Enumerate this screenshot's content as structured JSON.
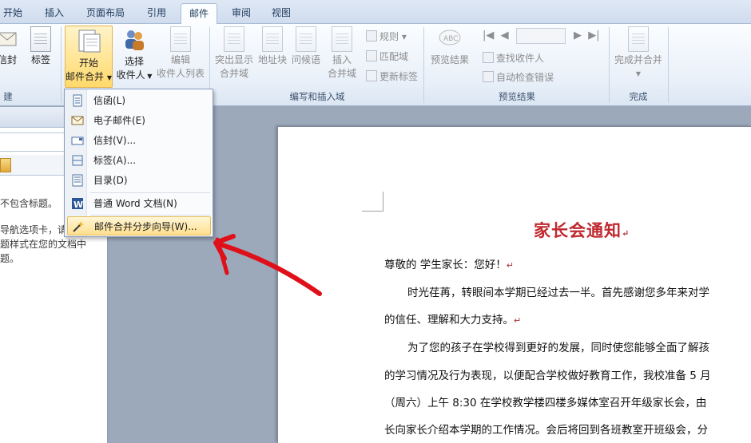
{
  "tabs": [
    "开始",
    "插入",
    "页面布局",
    "引用",
    "邮件",
    "审阅",
    "视图"
  ],
  "active_tab": "邮件",
  "ribbon": {
    "create_group": {
      "envelope": "信封",
      "labels": "标签",
      "label_partial": "建"
    },
    "start_group": {
      "start_merge_line1": "开始",
      "start_merge_line2": "邮件合并",
      "select_recipients_line1": "选择",
      "select_recipients_line2": "收件人",
      "edit_recipients_line1": "编辑",
      "edit_recipients_line2": "收件人列表"
    },
    "write_insert_group": {
      "highlight_line1": "突出显示",
      "highlight_line2": "合并域",
      "address_block": "地址块",
      "greeting_line": "问候语",
      "insert_field_line1": "插入",
      "insert_field_line2": "合并域",
      "rules": "规则",
      "match_fields": "匹配域",
      "update_labels": "更新标签",
      "label": "编写和插入域"
    },
    "preview_group": {
      "preview_results": "预览结果",
      "find_recipient": "查找收件人",
      "auto_check": "自动检查错误",
      "label": "预览结果"
    },
    "finish_group": {
      "finish_merge": "完成并合并",
      "label": "完成"
    }
  },
  "menu": {
    "items": [
      {
        "label": "信函(L)",
        "icon": "letter-icon"
      },
      {
        "label": "电子邮件(E)",
        "icon": "email-icon"
      },
      {
        "label": "信封(V)...",
        "icon": "envelope-icon"
      },
      {
        "label": "标签(A)...",
        "icon": "label-icon"
      },
      {
        "label": "目录(D)",
        "icon": "directory-icon"
      },
      {
        "label": "普通 Word 文档(N)",
        "icon": "word-doc-icon"
      },
      {
        "label": "邮件合并分步向导(W)...",
        "icon": "wizard-icon"
      }
    ]
  },
  "navpane": {
    "line1": "不包含标题。",
    "line2": "导航选项卡，请",
    "line3": "题样式在您的文档中",
    "line4": "题。"
  },
  "document": {
    "title": "家长会通知",
    "line1": "尊敬的        学生家长：您好！",
    "line2": "时光荏苒，转眼间本学期已经过去一半。首先感谢您多年来对学",
    "line3": "的信任、理解和大力支持。",
    "line4": "为了您的孩子在学校得到更好的发展，同时使您能够全面了解孩",
    "line5": "的学习情况及行为表现，以便配合学校做好教育工作，我校准备 5 月",
    "line6": "（周六）上午 8:30 在学校教学楼四楼多媒体室召开年级家长会，由",
    "line7": "长向家长介绍本学期的工作情况。会后将回到各班教室开班级会，分"
  },
  "colors": {
    "accent_red": "#c0292f",
    "annotation_arrow": "#e0101a",
    "menu_highlight": "#ffe08f"
  }
}
